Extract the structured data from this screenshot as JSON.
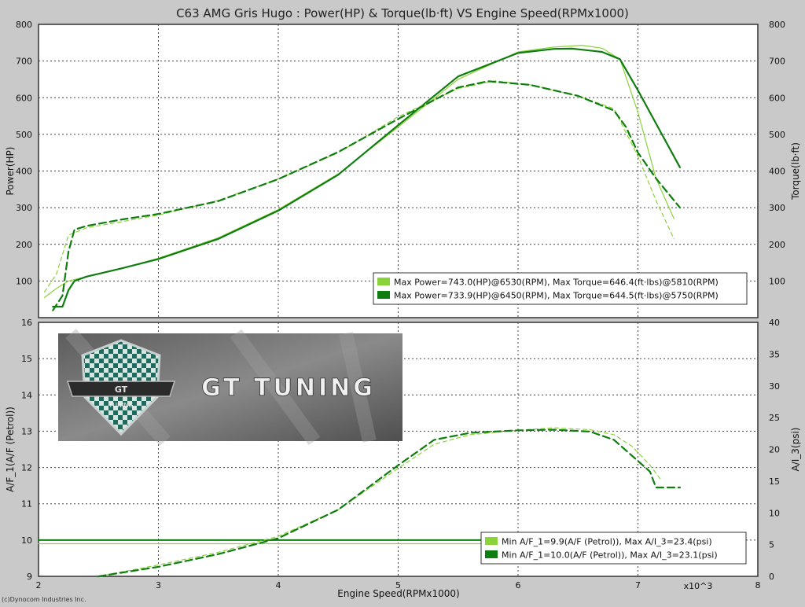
{
  "title": "C63 AMG Gris Hugo : Power(HP) & Torque(lb·ft) VS Engine Speed(RPMx1000)",
  "footer": "(c)Dynocom Industries Inc.",
  "x_axis": {
    "label": "Engine Speed(RPMx1000)",
    "unit_label": "x10^3"
  },
  "logo": {
    "text": "GT TUNING",
    "badge_text": "GT",
    "badge_sub": "TUNING"
  },
  "colors": {
    "light": "#8bd33a",
    "dark": "#0f7d0f",
    "background": "#c9c9c9",
    "panel": "#ffffff"
  },
  "chart_data": [
    {
      "type": "line",
      "ylabel": "Power(HP)",
      "ylabel_right": "Torque(lb·ft)",
      "xlim": [
        2,
        8
      ],
      "ylim": [
        0,
        800
      ],
      "ylim_right": [
        0,
        800
      ],
      "x_ticks": [
        "2",
        "3",
        "4",
        "5",
        "6",
        "7",
        "8"
      ],
      "y_ticks": [
        "0",
        "100",
        "200",
        "300",
        "400",
        "500",
        "600",
        "700",
        "800"
      ],
      "y_ticks_right": [
        "0",
        "100",
        "200",
        "300",
        "400",
        "500",
        "600",
        "700",
        "800"
      ],
      "grid": true,
      "legend_position": "bottom-right",
      "legend": [
        "Max Power=743.0(HP)@6530(RPM), Max Torque=646.4(ft·lbs)@5810(RPM)",
        "Max Power=733.9(HP)@6450(RPM), Max Torque=644.5(ft·lbs)@5750(RPM)"
      ],
      "series": [
        {
          "color": "light",
          "style": "solid",
          "width": 1.2,
          "axis": "left",
          "x": [
            2.05,
            2.15,
            2.25,
            2.4,
            2.7,
            3.0,
            3.5,
            4.0,
            4.5,
            5.0,
            5.5,
            6.0,
            6.3,
            6.53,
            6.7,
            6.85,
            7.0,
            7.15,
            7.3
          ],
          "y": [
            55,
            80,
            100,
            112,
            135,
            162,
            218,
            295,
            392,
            520,
            650,
            725,
            738,
            743,
            735,
            705,
            560,
            380,
            270
          ]
        },
        {
          "color": "dark",
          "style": "solid",
          "width": 2.2,
          "axis": "left",
          "x": [
            2.12,
            2.2,
            2.25,
            2.3,
            2.4,
            2.7,
            3.0,
            3.5,
            4.0,
            4.5,
            5.0,
            5.5,
            6.0,
            6.3,
            6.45,
            6.7,
            6.85,
            7.0,
            7.2,
            7.35
          ],
          "y": [
            30,
            30,
            75,
            100,
            112,
            135,
            160,
            215,
            292,
            390,
            525,
            658,
            722,
            733,
            734,
            725,
            705,
            620,
            500,
            410
          ]
        },
        {
          "color": "light",
          "style": "dashed",
          "width": 1.2,
          "axis": "right",
          "x": [
            2.05,
            2.15,
            2.25,
            2.4,
            2.7,
            3.0,
            3.5,
            4.0,
            4.5,
            5.0,
            5.5,
            5.81,
            6.1,
            6.5,
            6.8,
            7.0,
            7.15,
            7.3
          ],
          "y": [
            70,
            120,
            225,
            245,
            262,
            280,
            320,
            378,
            450,
            548,
            625,
            646,
            635,
            605,
            570,
            440,
            320,
            215
          ]
        },
        {
          "color": "dark",
          "style": "dashed",
          "width": 2.2,
          "axis": "right",
          "x": [
            2.12,
            2.2,
            2.25,
            2.3,
            2.4,
            2.7,
            3.0,
            3.5,
            4.0,
            4.5,
            5.0,
            5.5,
            5.75,
            6.1,
            6.5,
            6.8,
            6.9,
            7.0,
            7.15,
            7.35
          ],
          "y": [
            20,
            60,
            180,
            240,
            250,
            268,
            283,
            318,
            378,
            452,
            542,
            628,
            645,
            635,
            605,
            565,
            520,
            450,
            380,
            300
          ]
        }
      ]
    },
    {
      "type": "line",
      "ylabel": "A/F_1(A/F (Petrol))",
      "ylabel_right": "A/I_3(psi)",
      "xlim": [
        2,
        8
      ],
      "ylim": [
        9,
        16
      ],
      "ylim_right": [
        0,
        40
      ],
      "x_ticks": [
        "2",
        "3",
        "4",
        "5",
        "6",
        "7",
        "8"
      ],
      "y_ticks": [
        "9",
        "10",
        "11",
        "12",
        "13",
        "14",
        "15",
        "16"
      ],
      "y_ticks_right": [
        "0",
        "5",
        "10",
        "15",
        "20",
        "25",
        "30",
        "35",
        "40"
      ],
      "grid": true,
      "legend_position": "bottom-right",
      "legend": [
        "Min A/F_1=9.9(A/F (Petrol)), Max A/I_3=23.4(psi)",
        "Min A/F_1=10.0(A/F (Petrol)), Max A/I_3=23.1(psi)"
      ],
      "series": [
        {
          "color": "light",
          "style": "solid",
          "width": 1.2,
          "axis": "left",
          "x": [
            2.0,
            7.3
          ],
          "y": [
            9.9,
            9.9
          ]
        },
        {
          "color": "dark",
          "style": "solid",
          "width": 2.0,
          "axis": "left",
          "x": [
            2.0,
            7.3
          ],
          "y": [
            10.0,
            10.0
          ]
        },
        {
          "color": "light",
          "style": "dashed",
          "width": 1.2,
          "axis": "right",
          "x": [
            2.5,
            3.0,
            3.5,
            4.0,
            4.5,
            5.0,
            5.3,
            5.6,
            6.0,
            6.3,
            6.6,
            6.8,
            6.95,
            7.1,
            7.2
          ],
          "y": [
            0,
            1.8,
            3.8,
            6.3,
            10.5,
            17.0,
            20.8,
            22.3,
            23.0,
            23.4,
            23.1,
            22.3,
            20.5,
            17.5,
            15.0
          ]
        },
        {
          "color": "dark",
          "style": "dashed",
          "width": 2.2,
          "axis": "right",
          "x": [
            2.5,
            3.0,
            3.5,
            4.0,
            4.5,
            5.0,
            5.3,
            5.6,
            6.0,
            6.3,
            6.6,
            6.8,
            6.95,
            7.1,
            7.15,
            7.35
          ],
          "y": [
            0,
            1.5,
            3.5,
            6.0,
            10.5,
            17.5,
            21.5,
            22.6,
            23.0,
            23.1,
            22.8,
            21.5,
            19.0,
            16.5,
            14.0,
            14.0
          ]
        }
      ]
    }
  ]
}
